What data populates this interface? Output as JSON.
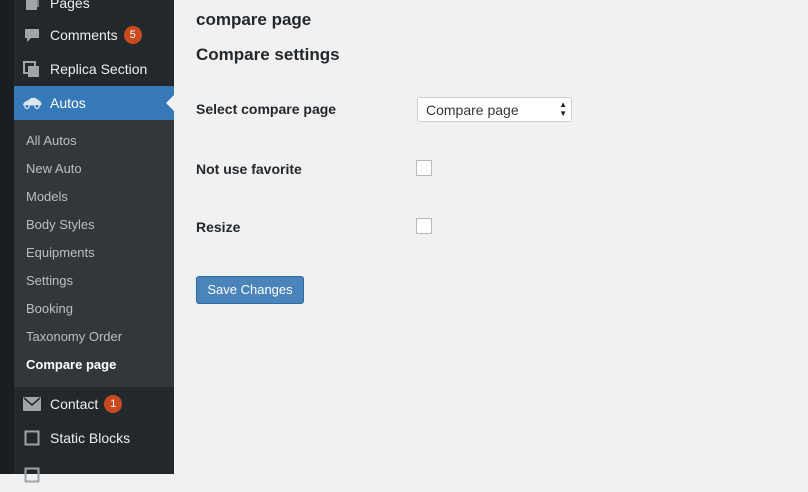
{
  "sidebar": {
    "items": [
      {
        "label": "Pages",
        "icon": "pages-icon"
      },
      {
        "label": "Comments",
        "icon": "comment-icon",
        "badge": "5"
      },
      {
        "label": "Replica Section",
        "icon": "replica-icon"
      },
      {
        "label": "Autos",
        "icon": "car-icon"
      },
      {
        "label": "Contact",
        "icon": "mail-icon",
        "badge": "1"
      },
      {
        "label": "Static Blocks",
        "icon": "square-icon"
      }
    ],
    "submenu": [
      "All Autos",
      "New Auto",
      "Models",
      "Body Styles",
      "Equipments",
      "Settings",
      "Booking",
      "Taxonomy Order",
      "Compare page"
    ]
  },
  "main": {
    "page_heading": "compare page",
    "section_title": "Compare settings",
    "fields": {
      "select_label": "Select compare page",
      "select_value": "Compare page",
      "favorite_label": "Not use favorite",
      "resize_label": "Resize"
    },
    "save_label": "Save Changes"
  },
  "colors": {
    "sidebar_bg": "#23282d",
    "submenu_bg": "#32373c",
    "active_blue": "#3679b8",
    "badge": "#ca4a1f",
    "button": "#4a84bb"
  }
}
